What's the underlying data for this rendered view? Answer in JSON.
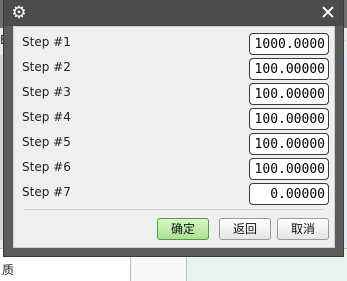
{
  "background": {
    "left_text": "E)",
    "right_text": "分",
    "bottom_left_text": "质"
  },
  "dialog": {
    "title_icon": "gear-icon",
    "close_icon": "close-icon",
    "steps": [
      {
        "label": "Step #1",
        "value": "1000.0000"
      },
      {
        "label": "Step #2",
        "value": "100.00000"
      },
      {
        "label": "Step #3",
        "value": "100.00000"
      },
      {
        "label": "Step #4",
        "value": "100.00000"
      },
      {
        "label": "Step #5",
        "value": "100.00000"
      },
      {
        "label": "Step #6",
        "value": "100.00000"
      },
      {
        "label": "Step #7",
        "value": "0.00000"
      }
    ],
    "buttons": {
      "ok": "确定",
      "back": "返回",
      "cancel": "取消"
    }
  }
}
